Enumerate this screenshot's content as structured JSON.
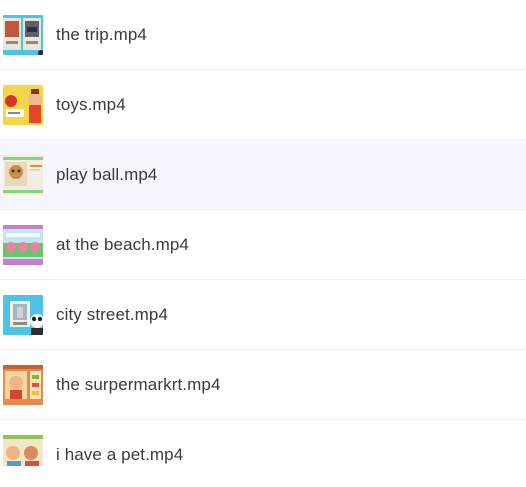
{
  "files": [
    {
      "name": "the trip.mp4",
      "icon": "video-thumbnail-icon"
    },
    {
      "name": "toys.mp4",
      "icon": "video-thumbnail-icon"
    },
    {
      "name": "play ball.mp4",
      "icon": "video-thumbnail-icon"
    },
    {
      "name": "at the beach.mp4",
      "icon": "video-thumbnail-icon"
    },
    {
      "name": "city street.mp4",
      "icon": "video-thumbnail-icon"
    },
    {
      "name": "the surpermarkrt.mp4",
      "icon": "video-thumbnail-icon"
    },
    {
      "name": "i have a pet.mp4",
      "icon": "video-thumbnail-icon"
    }
  ],
  "selected_index": 2,
  "colors": {
    "selected_row": "#f6f7fe",
    "divider": "#eeeeef",
    "text": "#3b3b3b"
  }
}
